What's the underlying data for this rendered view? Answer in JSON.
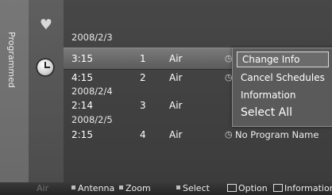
{
  "side_tab": {
    "label": "Programmed"
  },
  "list": {
    "groups": [
      {
        "date": "2008/2/3",
        "time": "3:15",
        "channel": "1",
        "source": "Air",
        "program": ""
      },
      {
        "date": "",
        "time": "4:15",
        "channel": "2",
        "source": "Air",
        "program": ""
      },
      {
        "date": "2008/2/4",
        "time": "2:14",
        "channel": "3",
        "source": "Air",
        "program": ""
      },
      {
        "date": "2008/2/5",
        "time": "2:15",
        "channel": "4",
        "source": "Air",
        "program": "No Program Name"
      }
    ]
  },
  "popup": {
    "items": [
      {
        "label": "Change Info"
      },
      {
        "label": "Cancel Schedules"
      },
      {
        "label": "Information"
      },
      {
        "label": "Select All"
      }
    ]
  },
  "bottom_bar": {
    "air": "Air",
    "antenna": "Antenna",
    "zoom": "Zoom",
    "select": "Select",
    "option": "Option",
    "information": "Information"
  }
}
